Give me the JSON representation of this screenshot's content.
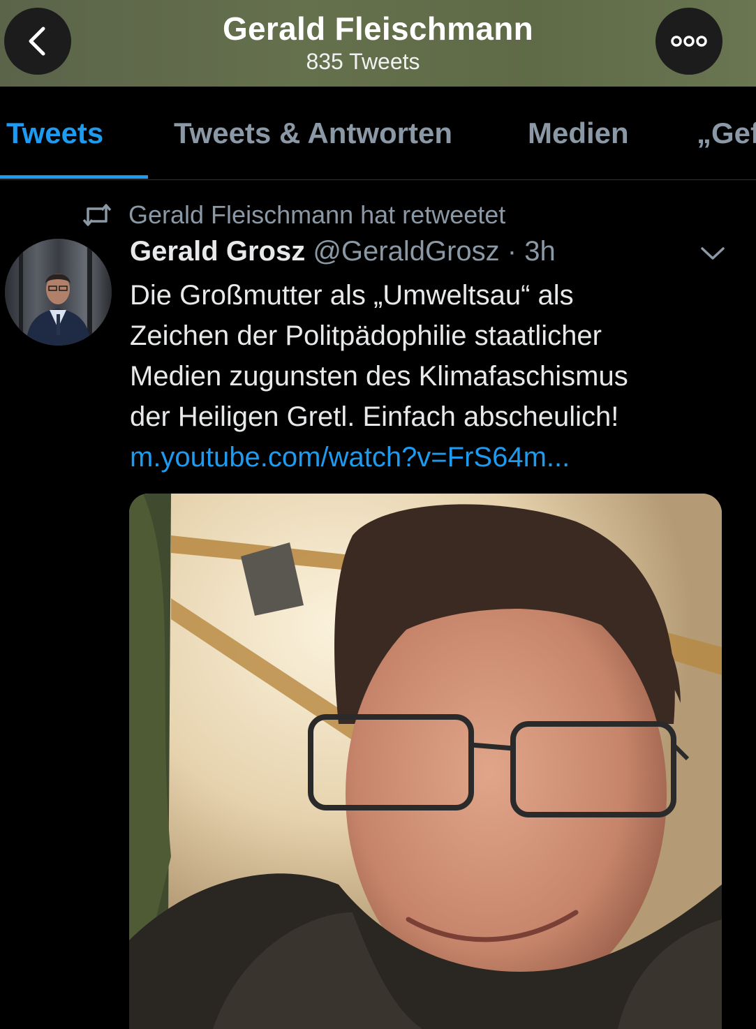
{
  "header": {
    "title": "Gerald Fleischmann",
    "subtitle": "835 Tweets",
    "back_icon": "chevron-left-icon",
    "more_icon": "more-horizontal-icon"
  },
  "tabs": [
    {
      "label": "Tweets",
      "active": true
    },
    {
      "label": "Tweets & Antworten",
      "active": false
    },
    {
      "label": "Medien",
      "active": false
    },
    {
      "label": "„Gef",
      "active": false
    }
  ],
  "tweet": {
    "retweet_label": "Gerald Fleischmann hat retweetet",
    "retweet_icon": "retweet-icon",
    "author_name": "Gerald Grosz",
    "author_meta": "@GeraldGrosz · 3h",
    "caret_icon": "chevron-down-icon",
    "text_lines": [
      "Die Großmutter als „Umweltsau“ als",
      "Zeichen der Politpädophilie staatlicher",
      "Medien zugunsten des Klimafaschismus",
      "der Heiligen Gretl. Einfach abscheulich!"
    ],
    "link": "m.youtube.com/watch?v=FrS64m..."
  },
  "colors": {
    "accent": "#1d9bf0",
    "muted": "#8b98a5",
    "background": "#000000"
  }
}
